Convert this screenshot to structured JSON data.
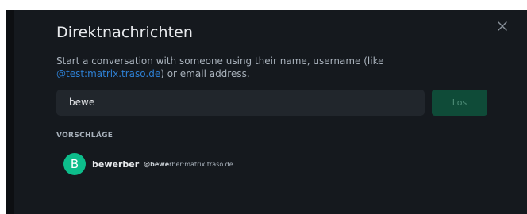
{
  "dialog": {
    "title": "Direktnachrichten",
    "description_before": "Start a conversation with someone using their name, username (like ",
    "description_link": "@test:matrix.traso.de",
    "description_after": ") or email address.",
    "search": {
      "value": "bewe"
    },
    "go_label": "Los",
    "close_icon": "close-icon"
  },
  "suggestions": {
    "heading": "VORSCHLÄGE",
    "items": [
      {
        "avatar_letter": "B",
        "display_name": "bewerber",
        "mxid_match": "@bewe",
        "mxid_rest": "rber:matrix.traso.de"
      }
    ]
  },
  "colors": {
    "accent": "#0dbd8b",
    "link": "#2d7fd3",
    "background": "#15191e"
  }
}
